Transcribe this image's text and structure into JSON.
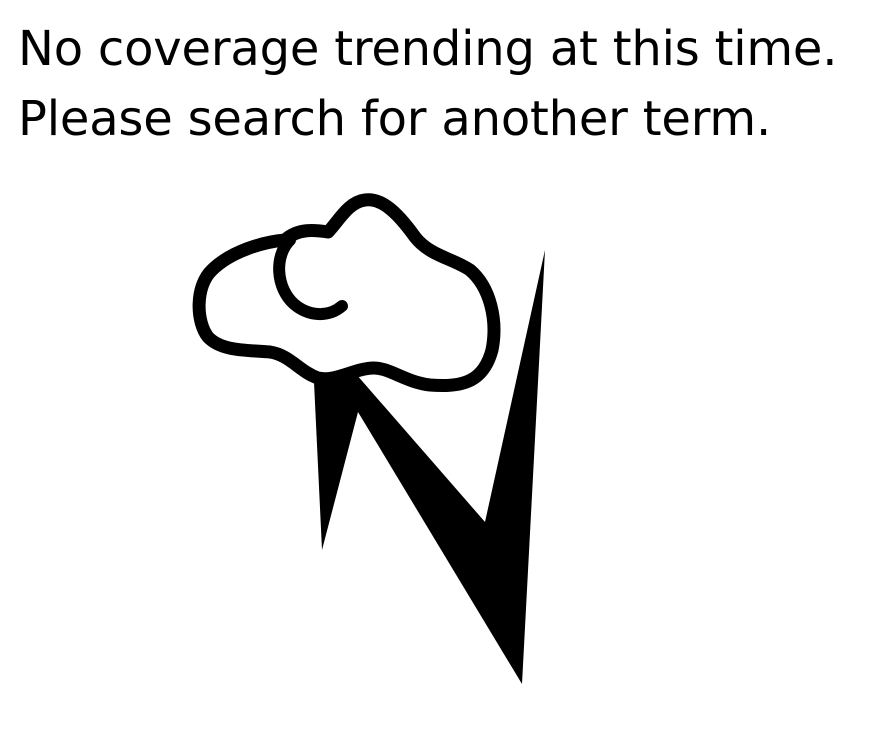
{
  "empty_state": {
    "line1": "No coverage trending at this time.",
    "line2": "Please search for another term.",
    "illustration_icon": "cloud-lightning-n-icon",
    "ink_color": "#000000",
    "background_color": "#ffffff"
  }
}
